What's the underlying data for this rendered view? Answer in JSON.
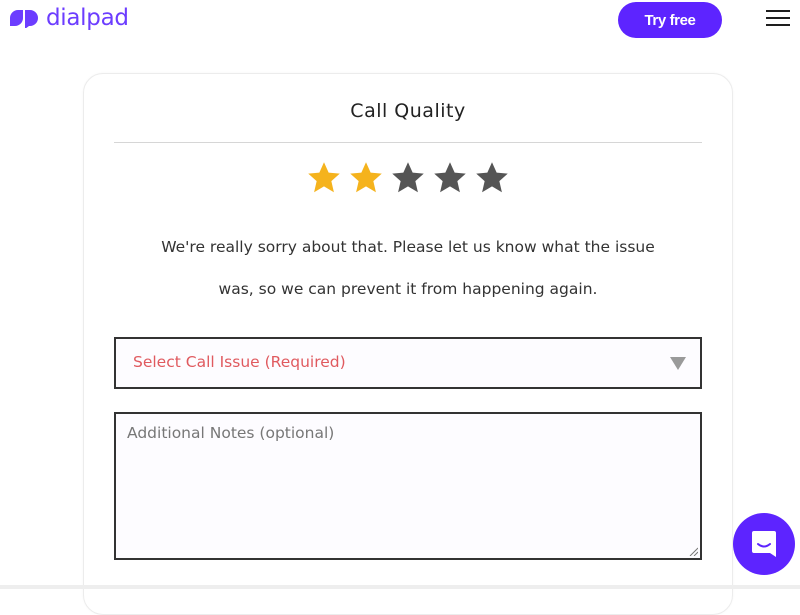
{
  "header": {
    "brand": "dialpad",
    "try_free_label": "Try free",
    "menu_icon": "hamburger-menu-icon",
    "brand_color": "#5d24ff"
  },
  "feedback": {
    "title": "Call Quality",
    "rating": {
      "value": 2,
      "max": 5,
      "filled_color": "#f5b31d",
      "empty_color": "#555555"
    },
    "message": "We're really sorry about that. Please let us know what the issue was, so we can prevent it from happening again.",
    "issue_select": {
      "selected": "Select Call Issue (Required)",
      "icon": "dropdown-triangle-icon"
    },
    "notes": {
      "placeholder": "Additional Notes (optional)",
      "value": ""
    }
  },
  "chat_widget": {
    "icon": "chat-bubble-smile-icon"
  }
}
